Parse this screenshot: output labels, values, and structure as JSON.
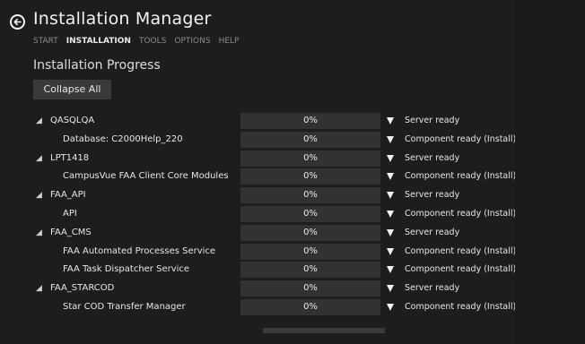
{
  "app": {
    "title": "Installation Manager"
  },
  "menu": {
    "items": [
      {
        "label": "START",
        "active": false
      },
      {
        "label": "INSTALLATION",
        "active": true
      },
      {
        "label": "TOOLS",
        "active": false
      },
      {
        "label": "OPTIONS",
        "active": false
      },
      {
        "label": "HELP",
        "active": false
      }
    ]
  },
  "progress": {
    "section_title": "Installation Progress",
    "collapse_label": "Collapse All",
    "rows": [
      {
        "level": "parent",
        "name": "QASQLQA",
        "percent": "0%",
        "status": "Server ready"
      },
      {
        "level": "child",
        "name": "Database: C2000Help_220",
        "percent": "0%",
        "status": "Component ready (Install)"
      },
      {
        "level": "parent",
        "name": "LPT1418",
        "percent": "0%",
        "status": "Server ready"
      },
      {
        "level": "child",
        "name": "CampusVue FAA Client Core Modules",
        "percent": "0%",
        "status": "Component ready (Install)"
      },
      {
        "level": "parent",
        "name": "FAA_API",
        "percent": "0%",
        "status": "Server ready"
      },
      {
        "level": "child",
        "name": "API",
        "percent": "0%",
        "status": "Component ready (Install)"
      },
      {
        "level": "parent",
        "name": "FAA_CMS",
        "percent": "0%",
        "status": "Server ready"
      },
      {
        "level": "child",
        "name": "FAA Automated Processes Service",
        "percent": "0%",
        "status": "Component ready (Install)"
      },
      {
        "level": "child",
        "name": "FAA Task Dispatcher Service",
        "percent": "0%",
        "status": "Component ready (Install)"
      },
      {
        "level": "parent",
        "name": "FAA_STARCOD",
        "percent": "0%",
        "status": "Server ready"
      },
      {
        "level": "child",
        "name": "Star COD Transfer Manager",
        "percent": "0%",
        "status": "Component ready (Install)"
      }
    ]
  },
  "icons": {
    "back": "back-arrow-icon",
    "expander": "collapse-expander-icon",
    "dropdown": "dropdown-triangle-icon"
  },
  "colors": {
    "background": "#1d1d1d",
    "progress_track": "#323232",
    "button": "#3a3a3a",
    "menu_inactive": "#8a8a8a",
    "text": "#e6e6e6"
  }
}
